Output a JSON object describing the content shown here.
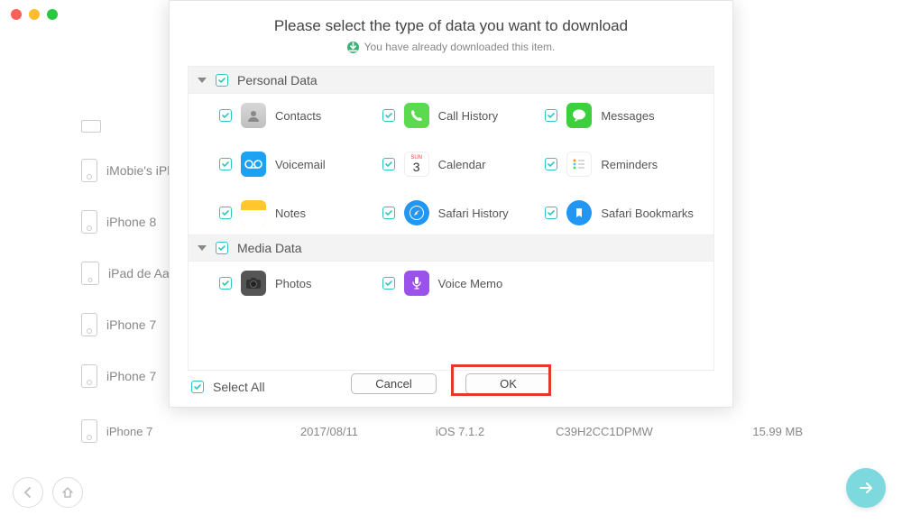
{
  "window": {
    "traffic": {
      "close": "close",
      "min": "minimize",
      "max": "maximize"
    }
  },
  "devices": {
    "row0": "",
    "row1": "iMobie's iPh…",
    "row2": "iPhone 8",
    "row3": "iPad de Aar…",
    "row4": "iPhone 7",
    "row5": "iPhone 7",
    "row6": "iPhone 7"
  },
  "bgFile": {
    "name": "iPhone 7",
    "date": "2017/08/11",
    "ios": "iOS 7.1.2",
    "sn": "C39H2CC1DPMW",
    "size": "15.99 MB"
  },
  "modal": {
    "title": "Please select the type of data you want to download",
    "subtitle": "You have already downloaded this item.",
    "categories": {
      "personal": {
        "header": "Personal Data",
        "items": {
          "contacts": "Contacts",
          "callhistory": "Call History",
          "messages": "Messages",
          "voicemail": "Voicemail",
          "calendar": "Calendar",
          "reminders": "Reminders",
          "notes": "Notes",
          "safarihistory": "Safari History",
          "safaribookmarks": "Safari Bookmarks"
        }
      },
      "media": {
        "header": "Media Data",
        "items": {
          "photos": "Photos",
          "voicememo": "Voice Memo"
        }
      }
    },
    "selectAll": "Select All",
    "cancel": "Cancel",
    "ok": "OK"
  }
}
